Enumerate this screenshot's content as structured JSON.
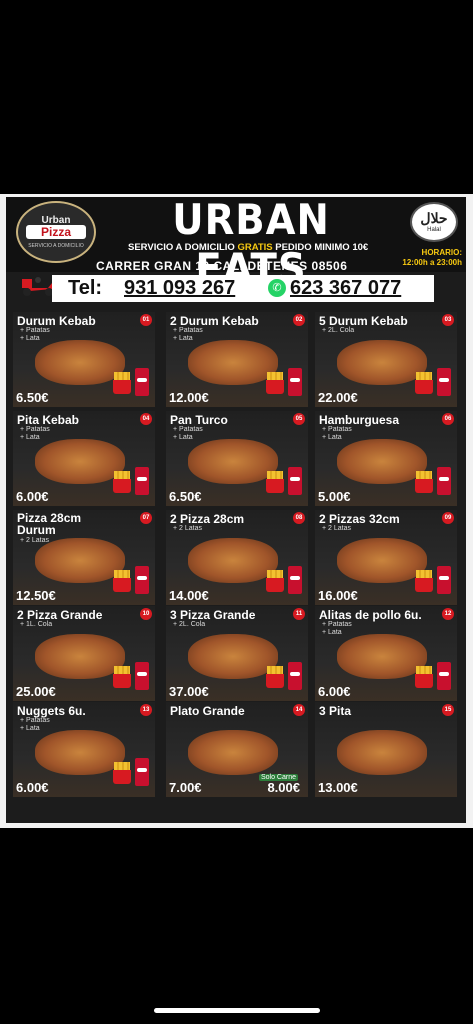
{
  "header": {
    "logo_top": "Urban",
    "logo_main": "Pizza",
    "logo_sub": "SERVICIO A DOMICILIO",
    "title": "URBAN EATS",
    "subtitle_before": "SERVICIO A DOMICILIO ",
    "subtitle_gratis": "GRATIS",
    "subtitle_after": " PEDIDO MINIMO 10€",
    "address": "CARRER GRAN 10 CALLDETENES 08506",
    "halal_ar": "حلال",
    "halal_en": "Halal",
    "horario_label": "HORARIO:",
    "horario_value": "12:00h a 23:00h",
    "tel_label": "Tel:",
    "phone1": "931 093 267",
    "phone2": "623 367 077"
  },
  "items": [
    {
      "num": "01",
      "name": "Durum Kebab",
      "extras": [
        "+ Patatas",
        "+ Lata"
      ],
      "price": "6.50€"
    },
    {
      "num": "02",
      "name": "2 Durum Kebab",
      "extras": [
        "+ Patatas",
        "+ Lata"
      ],
      "price": "12.00€"
    },
    {
      "num": "03",
      "name": "5 Durum Kebab",
      "extras": [
        "+ 2L. Cola"
      ],
      "price": "22.00€"
    },
    {
      "num": "04",
      "name": "Pita Kebab",
      "extras": [
        "+ Patatas",
        "+ Lata"
      ],
      "price": "6.00€"
    },
    {
      "num": "05",
      "name": "Pan Turco",
      "extras": [
        "+ Patatas",
        "+ Lata"
      ],
      "price": "6.50€"
    },
    {
      "num": "06",
      "name": "Hamburguesa",
      "extras": [
        "+ Patatas",
        "+ Lata"
      ],
      "price": "5.00€"
    },
    {
      "num": "07",
      "name": "Pizza 28cm\nDurum",
      "extras": [
        "+ 2 Latas"
      ],
      "price": "12.50€"
    },
    {
      "num": "08",
      "name": "2 Pizza 28cm",
      "extras": [
        "+ 2 Latas"
      ],
      "price": "14.00€"
    },
    {
      "num": "09",
      "name": "2 Pizzas 32cm",
      "extras": [
        "+ 2 Latas"
      ],
      "price": "16.00€"
    },
    {
      "num": "10",
      "name": "2 Pizza Grande",
      "extras": [
        "+ 1L. Cola"
      ],
      "price": "25.00€"
    },
    {
      "num": "11",
      "name": "3 Pizza Grande",
      "extras": [
        "+ 2L. Cola"
      ],
      "price": "37.00€"
    },
    {
      "num": "12",
      "name": "Alitas de pollo 6u.",
      "extras": [
        "+ Patatas",
        "+ Lata"
      ],
      "price": "6.00€"
    },
    {
      "num": "13",
      "name": "Nuggets  6u.",
      "extras": [
        "+ Patatas",
        "+ Lata"
      ],
      "price": "6.00€"
    },
    {
      "num": "14",
      "name": "Plato Grande",
      "extras": [],
      "price": "7.00€",
      "price2": "8.00€",
      "note": "Solo Carne"
    },
    {
      "num": "15",
      "name": "3 Pita",
      "extras": [],
      "price": "13.00€"
    }
  ],
  "colors": {
    "accent_red": "#d71a21",
    "gold": "#f7c911",
    "whatsapp": "#25d366"
  },
  "icons": [
    "scooter-icon",
    "whatsapp-icon",
    "halal-badge-icon",
    "cola-can-icon",
    "fries-icon"
  ]
}
